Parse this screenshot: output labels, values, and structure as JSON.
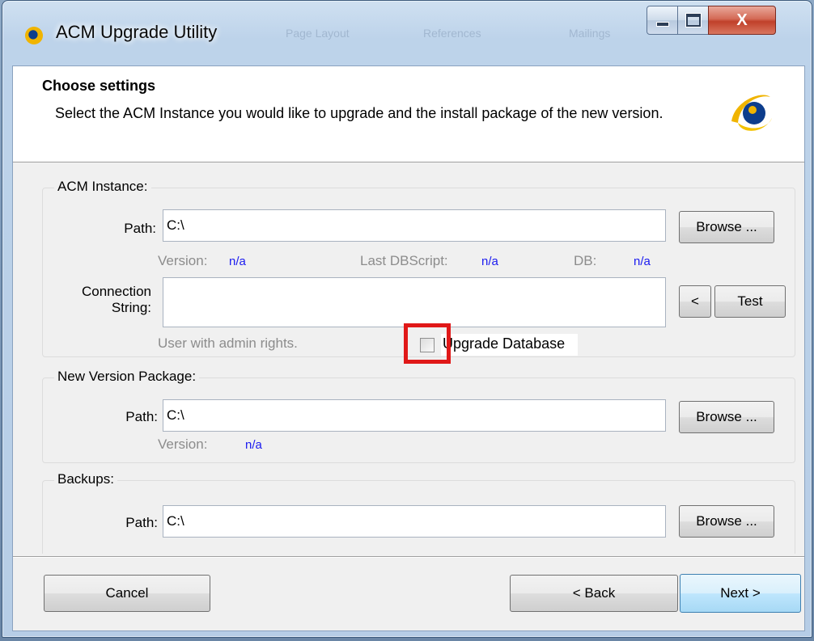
{
  "window": {
    "title": "ACM Upgrade Utility",
    "ghost_tabs": [
      "Page Layout",
      "References",
      "Mailings"
    ],
    "controls": {
      "minimize": "minimize",
      "maximize": "maximize",
      "close": "X"
    }
  },
  "header": {
    "title": "Choose settings",
    "description": "Select the ACM Instance you would like to upgrade and the install package of the new version."
  },
  "acm_instance": {
    "group_label": "ACM Instance:",
    "path_label": "Path:",
    "path_value": "C:\\",
    "browse_label": "Browse ...",
    "version_label": "Version:",
    "version_value": "n/a",
    "last_dbscript_label": "Last DBScript:",
    "last_dbscript_value": "n/a",
    "db_label": "DB:",
    "db_value": "n/a",
    "connection_label_1": "Connection",
    "connection_label_2": "String:",
    "connection_value": "",
    "back_arrow_label": "<",
    "test_label": "Test",
    "admin_hint": "User with admin rights.",
    "upgrade_db_label": "Upgrade Database",
    "upgrade_db_checked": false
  },
  "new_version": {
    "group_label": "New Version Package:",
    "path_label": "Path:",
    "path_value": "C:\\",
    "browse_label": "Browse ...",
    "version_label": "Version:",
    "version_value": "n/a"
  },
  "backups": {
    "group_label": "Backups:",
    "path_label": "Path:",
    "path_value": "C:\\",
    "browse_label": "Browse ..."
  },
  "footer": {
    "cancel_label": "Cancel",
    "back_label": "< Back",
    "next_label": "Next >"
  },
  "colors": {
    "value_blue": "#1a1af0",
    "highlight_red": "#e01818",
    "logo_yellow": "#f0b400",
    "logo_blue": "#0d3d8c"
  }
}
